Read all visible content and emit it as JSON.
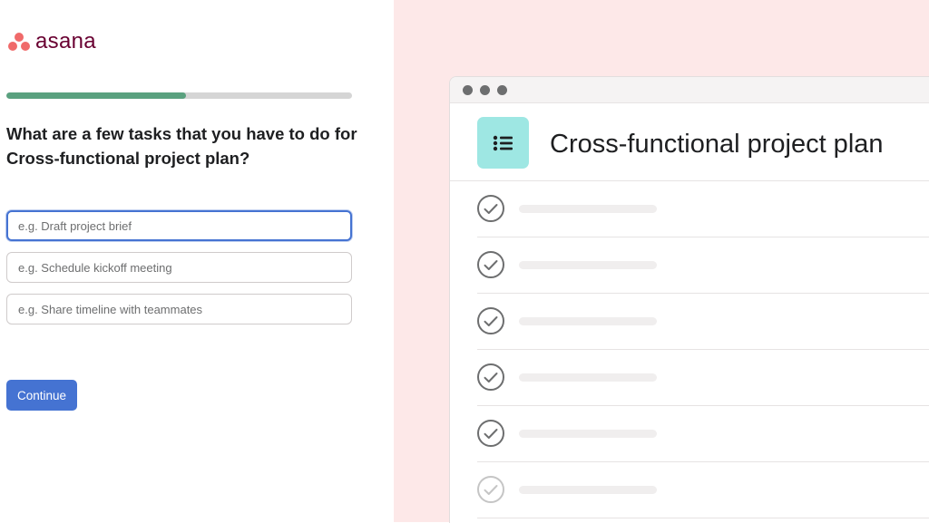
{
  "brand": {
    "name": "asana",
    "logo_dot_color": "#f06a6a",
    "text_color": "#690031"
  },
  "progress": {
    "fraction": 0.52,
    "color": "#5aa17f"
  },
  "question": "What are a few tasks that you have to do for Cross-functional project plan?",
  "task_inputs": [
    {
      "placeholder": "e.g. Draft project brief",
      "value": ""
    },
    {
      "placeholder": "e.g. Schedule kickoff meeting",
      "value": ""
    },
    {
      "placeholder": "e.g. Share timeline with teammates",
      "value": ""
    }
  ],
  "continue_label": "Continue",
  "colors": {
    "accent": "#4573d2",
    "preview_background": "#fde8e8",
    "project_icon_bg": "#9ee7e3"
  },
  "preview": {
    "project_title": "Cross-functional project plan",
    "project_icon": "list-icon",
    "task_count": 6
  }
}
